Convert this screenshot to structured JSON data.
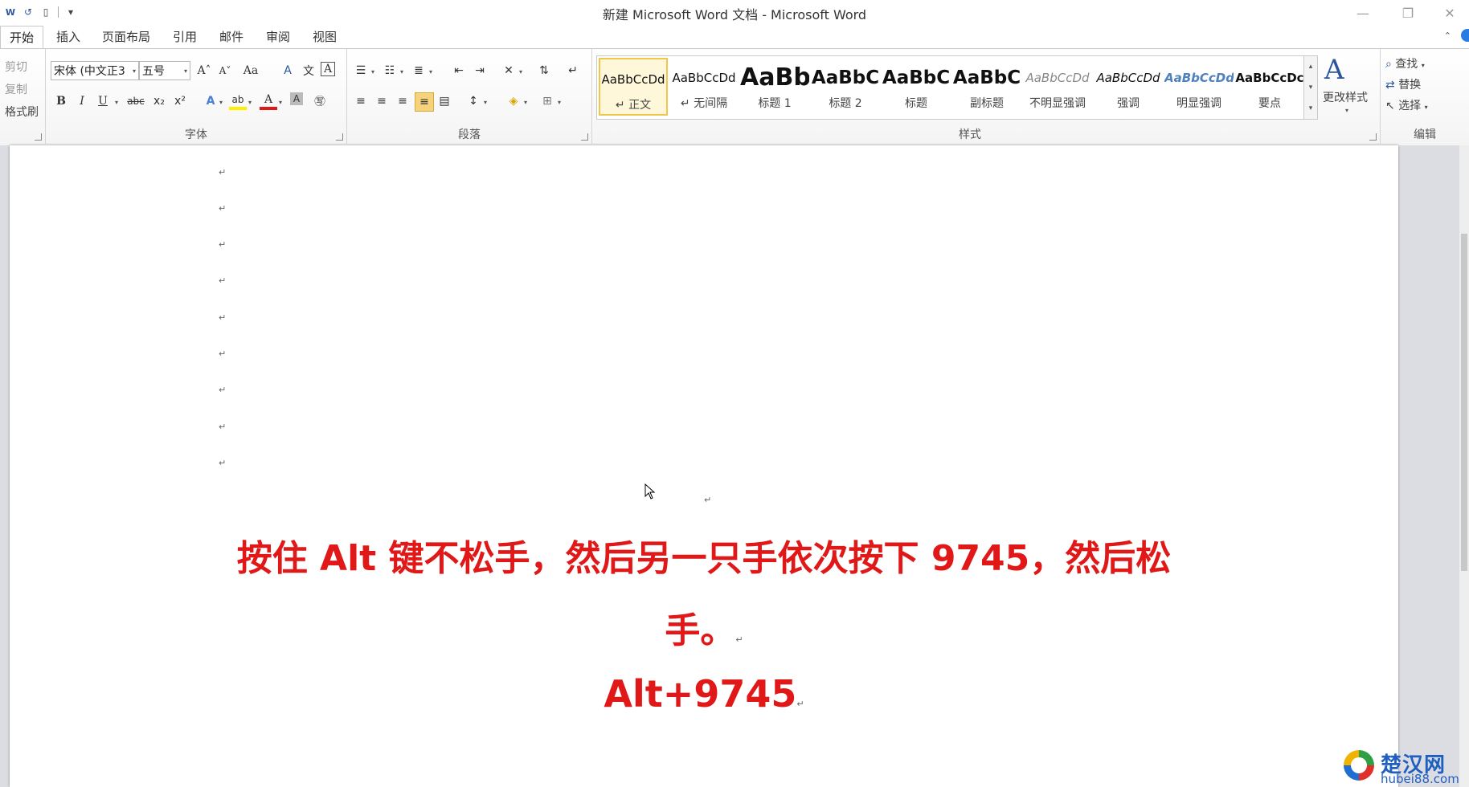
{
  "window": {
    "title": "新建 Microsoft Word 文档 - Microsoft Word",
    "controls": {
      "minimize": "—",
      "restore": "❐",
      "close": "✕"
    }
  },
  "quick_access": [
    {
      "name": "word-icon",
      "glyph": "W"
    },
    {
      "name": "undo-icon",
      "glyph": "↺"
    },
    {
      "name": "new-document-icon",
      "glyph": "▯"
    },
    {
      "name": "customize-qat-icon",
      "glyph": "▾"
    }
  ],
  "tabs": [
    "开始",
    "插入",
    "页面布局",
    "引用",
    "邮件",
    "审阅",
    "视图"
  ],
  "active_tab": "开始",
  "clipboard": {
    "cut": "剪切",
    "copy": "复制",
    "format_painter": "格式刷"
  },
  "font_group": {
    "label": "字体",
    "font_name": "宋体 (中文正3",
    "font_size": "五号",
    "grow": "A˄",
    "shrink": "A˅",
    "change_case": "Aa",
    "bold": "B",
    "italic": "I",
    "underline": "U",
    "strikethrough": "abc",
    "subscript": "x₂",
    "superscript": "x²",
    "text_effects": "A",
    "highlight": "ab",
    "font_color": "A",
    "char_shading": "A",
    "enclose": "㊢",
    "clear_format": "A",
    "phonetic": "文",
    "char_border": "A"
  },
  "paragraph_group": {
    "label": "段落"
  },
  "styles_group": {
    "label": "样式",
    "change_styles": "更改样式",
    "styles": [
      {
        "preview": "AaBbCcDd",
        "name": "↵ 正文"
      },
      {
        "preview": "AaBbCcDd",
        "name": "↵ 无间隔"
      },
      {
        "preview": "AaBb",
        "name": "标题 1"
      },
      {
        "preview": "AaBbC",
        "name": "标题 2"
      },
      {
        "preview": "AaBbC",
        "name": "标题"
      },
      {
        "preview": "AaBbC",
        "name": "副标题"
      },
      {
        "preview": "AaBbCcDd",
        "name": "不明显强调"
      },
      {
        "preview": "AaBbCcDd",
        "name": "强调"
      },
      {
        "preview": "AaBbCcDd",
        "name": "明显强调"
      },
      {
        "preview": "AaBbCcDc",
        "name": "要点"
      }
    ]
  },
  "editing_group": {
    "label": "编辑",
    "find": "查找",
    "replace": "替换",
    "select": "选择"
  },
  "document": {
    "paragraph_mark": "↵",
    "line1": "按住 Alt 键不松手，然后另一只手依次按下 9745，然后松",
    "line2": "手。",
    "line3": "Alt+9745",
    "accent_color": "#e01818"
  },
  "watermark": {
    "name": "楚汉网",
    "url": "hubei88.com"
  }
}
